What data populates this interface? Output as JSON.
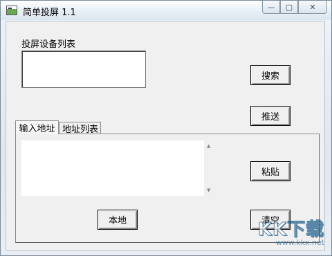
{
  "window": {
    "title": "简单投屏 1.1"
  },
  "caption": {
    "min": "—",
    "max": "▢",
    "close": "✕"
  },
  "devices": {
    "label": "投屏设备列表",
    "items": []
  },
  "buttons": {
    "search": "搜索",
    "push": "推送",
    "paste": "粘贴",
    "clear": "清空",
    "local": "本地"
  },
  "tabs": [
    {
      "label": "输入地址",
      "active": true
    },
    {
      "label": "地址列表",
      "active": false
    }
  ],
  "address_input": {
    "value": ""
  },
  "watermark": {
    "logo": "KK下载",
    "url": "www.kkx.net"
  }
}
